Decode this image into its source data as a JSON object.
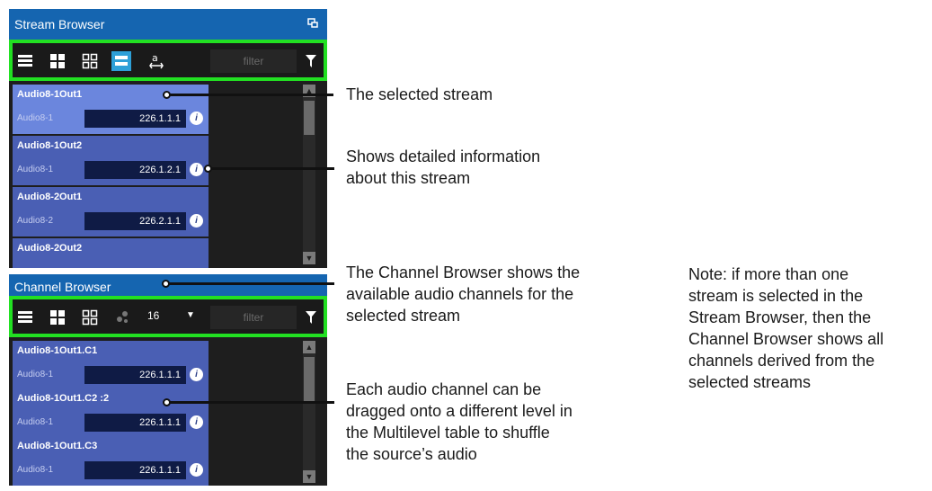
{
  "stream_browser": {
    "title": "Stream Browser",
    "filter_placeholder": "filter",
    "items": [
      {
        "name": "Audio8-1Out1",
        "sub": "Audio8-1",
        "ip": "226.1.1.1",
        "selected": true
      },
      {
        "name": "Audio8-1Out2",
        "sub": "Audio8-1",
        "ip": "226.1.2.1",
        "selected": false
      },
      {
        "name": "Audio8-2Out1",
        "sub": "Audio8-2",
        "ip": "226.2.1.1",
        "selected": false
      },
      {
        "name": "Audio8-2Out2",
        "sub": "",
        "ip": "",
        "selected": false
      }
    ]
  },
  "channel_browser": {
    "title": "Channel Browser",
    "filter_placeholder": "filter",
    "count": "16",
    "items": [
      {
        "name": "Audio8-1Out1.C1",
        "sub": "Audio8-1",
        "ip": "226.1.1.1"
      },
      {
        "name": "Audio8-1Out1.C2 :2",
        "sub": "Audio8-1",
        "ip": "226.1.1.1"
      },
      {
        "name": "Audio8-1Out1.C3",
        "sub": "Audio8-1",
        "ip": "226.1.1.1"
      }
    ]
  },
  "annotations": {
    "selected_stream": "The selected stream",
    "detailed_info": "Shows detailed information\nabout this stream",
    "channel_browser": "The Channel Browser shows the\navailable audio channels for the\nselected stream",
    "drag_channel": "Each audio channel can be\ndragged onto a different level in\nthe Multilevel table to shuffle\nthe source’s audio",
    "note": "Note: if more than one\nstream is selected in the\nStream Browser, then the\nChannel Browser shows all\nchannels derived from the\nselected streams"
  },
  "icons": {
    "info": "i"
  },
  "colors": {
    "accent_green": "#22e022",
    "panel_blue": "#1565b0",
    "item_blue": "#4a5fb4",
    "item_selected": "#6b86dd"
  }
}
